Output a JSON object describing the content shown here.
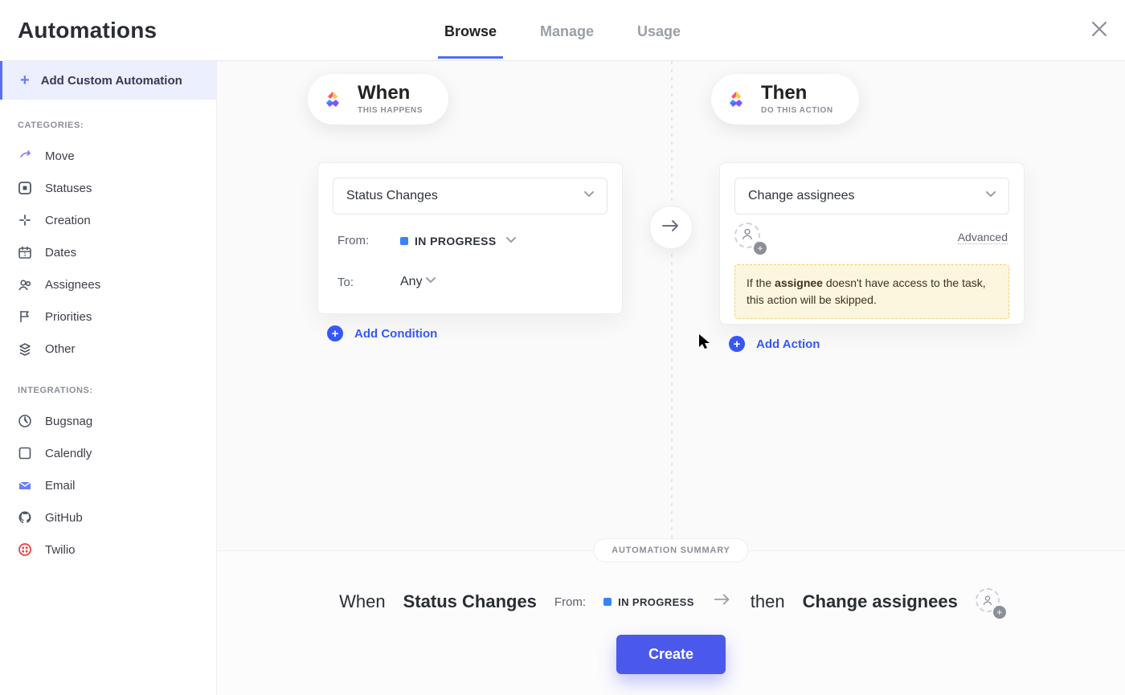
{
  "header": {
    "title": "Automations",
    "tabs": [
      "Browse",
      "Manage",
      "Usage"
    ],
    "active_tab": "Browse"
  },
  "sidebar": {
    "add_custom": "Add Custom Automation",
    "categories_label": "CATEGORIES:",
    "categories": [
      {
        "icon": "move-icon",
        "label": "Move"
      },
      {
        "icon": "statuses-icon",
        "label": "Statuses"
      },
      {
        "icon": "creation-icon",
        "label": "Creation"
      },
      {
        "icon": "dates-icon",
        "label": "Dates"
      },
      {
        "icon": "assignees-icon",
        "label": "Assignees"
      },
      {
        "icon": "priorities-icon",
        "label": "Priorities"
      },
      {
        "icon": "other-icon",
        "label": "Other"
      }
    ],
    "integrations_label": "INTEGRATIONS:",
    "integrations": [
      {
        "icon": "bugsnag-icon",
        "label": "Bugsnag"
      },
      {
        "icon": "calendly-icon",
        "label": "Calendly"
      },
      {
        "icon": "email-icon",
        "label": "Email"
      },
      {
        "icon": "github-icon",
        "label": "GitHub"
      },
      {
        "icon": "twilio-icon",
        "label": "Twilio"
      }
    ]
  },
  "when": {
    "title": "When",
    "subtitle": "THIS HAPPENS",
    "trigger": "Status Changes",
    "from_label": "From:",
    "from_status": "IN PROGRESS",
    "from_status_color": "#3b82f6",
    "to_label": "To:",
    "to_value": "Any",
    "add_condition": "Add Condition"
  },
  "then": {
    "title": "Then",
    "subtitle": "DO THIS ACTION",
    "action": "Change assignees",
    "advanced_label": "Advanced",
    "warning_prefix": "If the ",
    "warning_bold": "assignee",
    "warning_suffix": " doesn't have access to the task, this action will be skipped.",
    "add_action": "Add Action"
  },
  "summary": {
    "title": "AUTOMATION SUMMARY",
    "when_word": "When",
    "trigger": "Status Changes",
    "from_label": "From:",
    "from_status": "IN PROGRESS",
    "then_word": "then",
    "action": "Change assignees",
    "create_button": "Create"
  },
  "colors": {
    "accent": "#4a59ec",
    "link": "#3758f9",
    "warning_bg": "#fdf6df",
    "warning_border": "#f0cf76"
  }
}
